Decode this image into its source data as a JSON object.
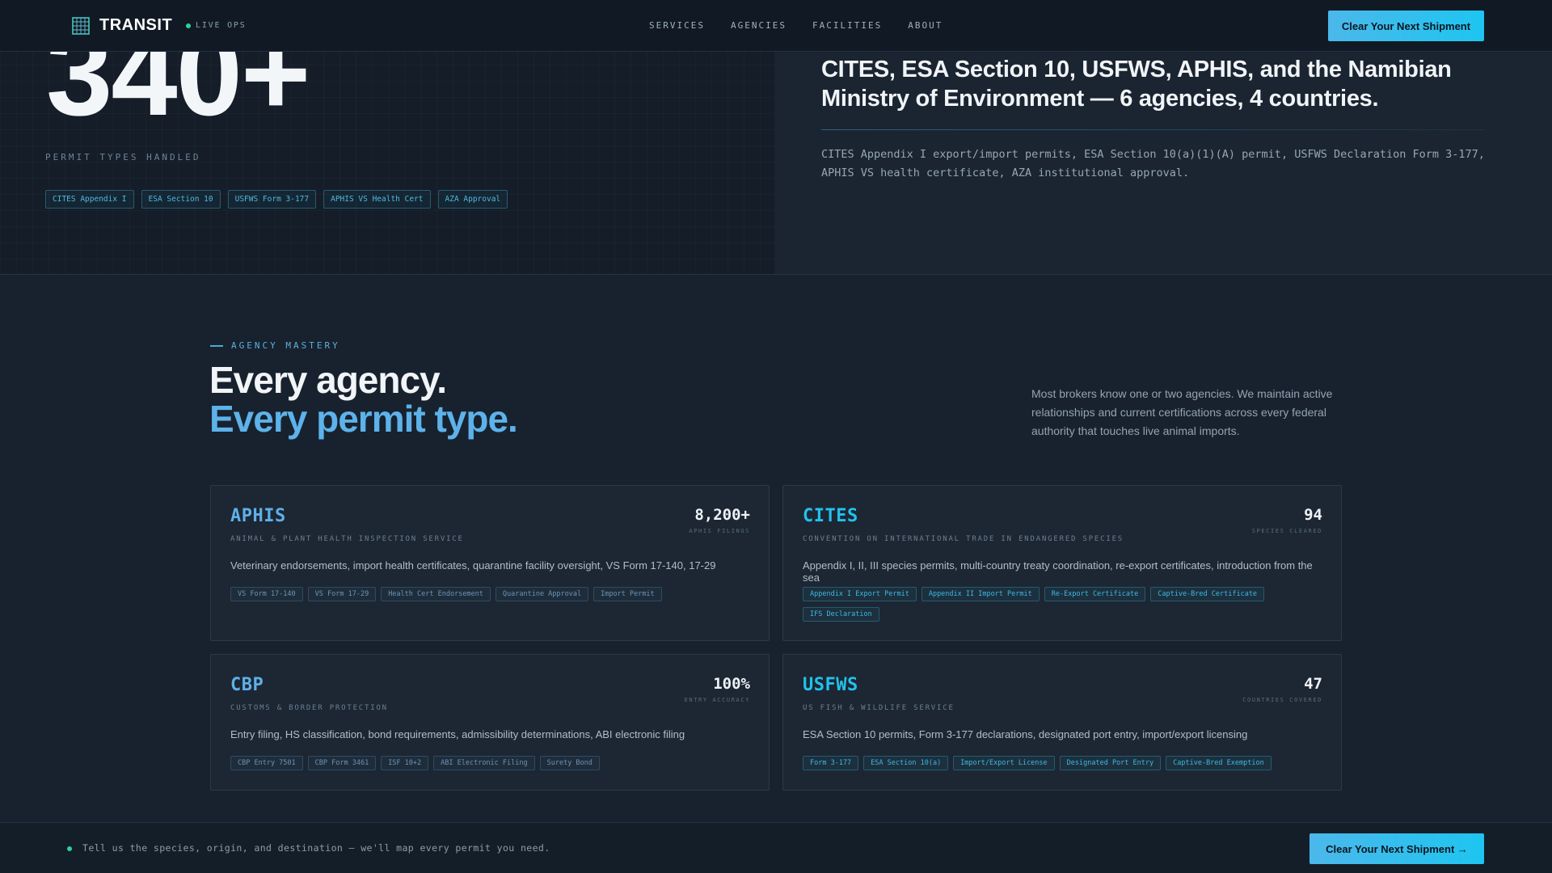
{
  "nav": {
    "brand": "TRANSIT",
    "live_label": "LIVE OPS",
    "links": [
      "SERVICES",
      "AGENCIES",
      "FACILITIES",
      "ABOUT"
    ],
    "cta": "Clear Your Next Shipment",
    "logo_icon": "grid-logo-icon"
  },
  "hero": {
    "big_number": "340+",
    "big_number_label": "PERMIT TYPES HANDLED",
    "tags": [
      "CITES Appendix I",
      "ESA Section 10",
      "USFWS Form 3-177",
      "APHIS VS Health Cert",
      "AZA Approval"
    ],
    "heading": "CITES, ESA Section 10, USFWS, APHIS, and the Namibian Ministry of Environment — 6 agencies, 4 countries.",
    "description": "CITES Appendix I export/import permits, ESA Section 10(a)(1)(A) permit, USFWS Declaration Form 3-177, APHIS VS health certificate, AZA institutional approval."
  },
  "agencies": {
    "eyebrow": "AGENCY MASTERY",
    "title_line1": "Every agency.",
    "title_line2": "Every permit type.",
    "description": "Most brokers know one or two agencies. We maintain active relationships and current certifications across every federal authority that touches live animal imports.",
    "cards": [
      {
        "name": "APHIS",
        "full_name": "ANIMAL & PLANT HEALTH INSPECTION SERVICE",
        "stat": "8,200+",
        "stat_label": "APHIS FILINGS",
        "description": "Veterinary endorsements, import health certificates, quarantine facility oversight, VS Form 17-140, 17-29",
        "tags": [
          "VS Form 17-140",
          "VS Form 17-29",
          "Health Cert Endorsement",
          "Quarantine Approval",
          "Import Permit"
        ]
      },
      {
        "name": "CITES",
        "full_name": "CONVENTION ON INTERNATIONAL TRADE IN ENDANGERED SPECIES",
        "stat": "94",
        "stat_label": "SPECIES CLEARED",
        "description": "Appendix I, II, III species permits, multi-country treaty coordination, re-export certificates, introduction from the sea",
        "tags": [
          "Appendix I Export Permit",
          "Appendix II Import Permit",
          "Re-Export Certificate",
          "Captive-Bred Certificate",
          "IFS Declaration"
        ]
      },
      {
        "name": "CBP",
        "full_name": "CUSTOMS & BORDER PROTECTION",
        "stat": "100%",
        "stat_label": "ENTRY ACCURACY",
        "description": "Entry filing, HS classification, bond requirements, admissibility determinations, ABI electronic filing",
        "tags": [
          "CBP Entry 7501",
          "CBP Form 3461",
          "ISF 10+2",
          "ABI Electronic Filing",
          "Surety Bond"
        ]
      },
      {
        "name": "USFWS",
        "full_name": "US FISH & WILDLIFE SERVICE",
        "stat": "47",
        "stat_label": "COUNTRIES COVERED",
        "description": "ESA Section 10 permits, Form 3-177 declarations, designated port entry, import/export licensing",
        "tags": [
          "Form 3-177",
          "ESA Section 10(a)",
          "Import/Export License",
          "Designated Port Entry",
          "Captive-Bred Exemption"
        ]
      }
    ]
  },
  "bottom_bar": {
    "message": "Tell us the species, origin, and destination — we'll map every permit you need.",
    "cta": "Clear Your Next Shipment →"
  },
  "colors": {
    "accent": "#4bb8ea",
    "live": "#2bd39a",
    "background": "#18222e"
  }
}
